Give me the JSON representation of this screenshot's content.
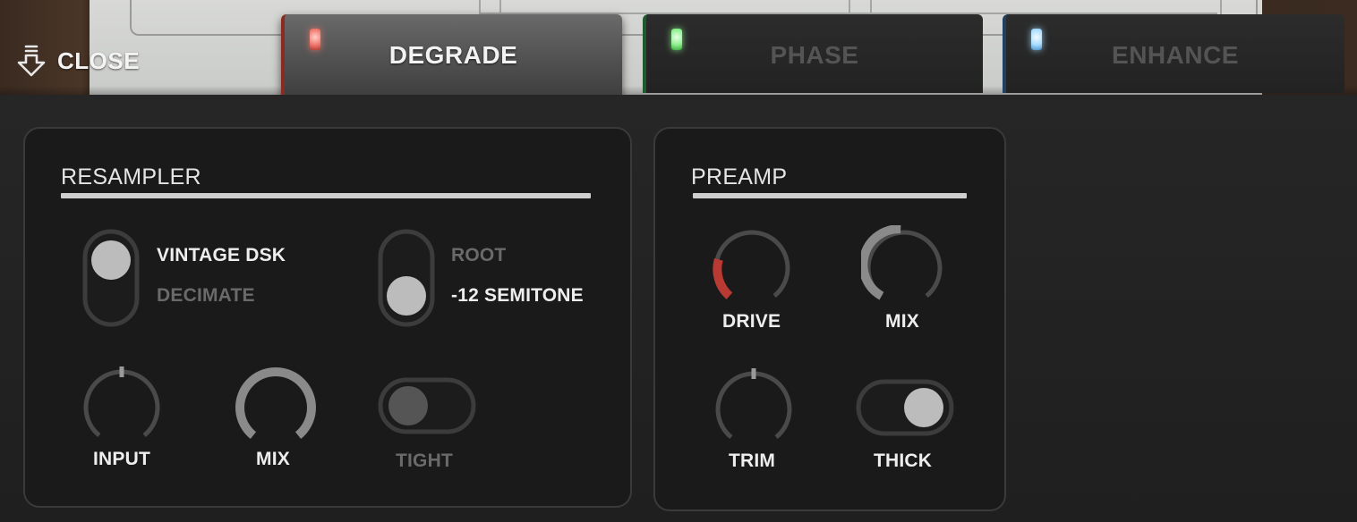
{
  "close": {
    "label": "CLOSE",
    "icon": "download-arrow-icon"
  },
  "tabs": [
    {
      "label": "DEGRADE",
      "active": true,
      "led_color": "#f08080",
      "accent": "#8a2b22"
    },
    {
      "label": "PHASE",
      "active": false,
      "led_color": "#8ef08e",
      "accent": "#1f5a2e"
    },
    {
      "label": "ENHANCE",
      "active": false,
      "led_color": "#a8dcff",
      "accent": "#1f4060"
    }
  ],
  "resampler": {
    "title": "RESAMPLER",
    "mode_switch": {
      "options": [
        "VINTAGE DSK",
        "DECIMATE"
      ],
      "selected": "VINTAGE DSK"
    },
    "pitch_switch": {
      "options": [
        "ROOT",
        "-12 SEMITONE"
      ],
      "selected": "-12 SEMITONE"
    },
    "input": {
      "label": "INPUT",
      "value": 0.5
    },
    "mix": {
      "label": "MIX",
      "value": 1.0
    },
    "tight": {
      "label": "TIGHT",
      "on": false
    }
  },
  "preamp": {
    "title": "PREAMP",
    "drive": {
      "label": "DRIVE",
      "value": 0.12,
      "color": "#b83a32"
    },
    "mix": {
      "label": "MIX",
      "value": 0.42
    },
    "trim": {
      "label": "TRIM",
      "value": 0.5
    },
    "thick": {
      "label": "THICK",
      "on": true
    }
  },
  "colors": {
    "knob_track": "#4a4a4a",
    "knob_fill": "#8a8a8a",
    "label_on": "#eeeeee",
    "label_off": "#6a6a6a"
  }
}
